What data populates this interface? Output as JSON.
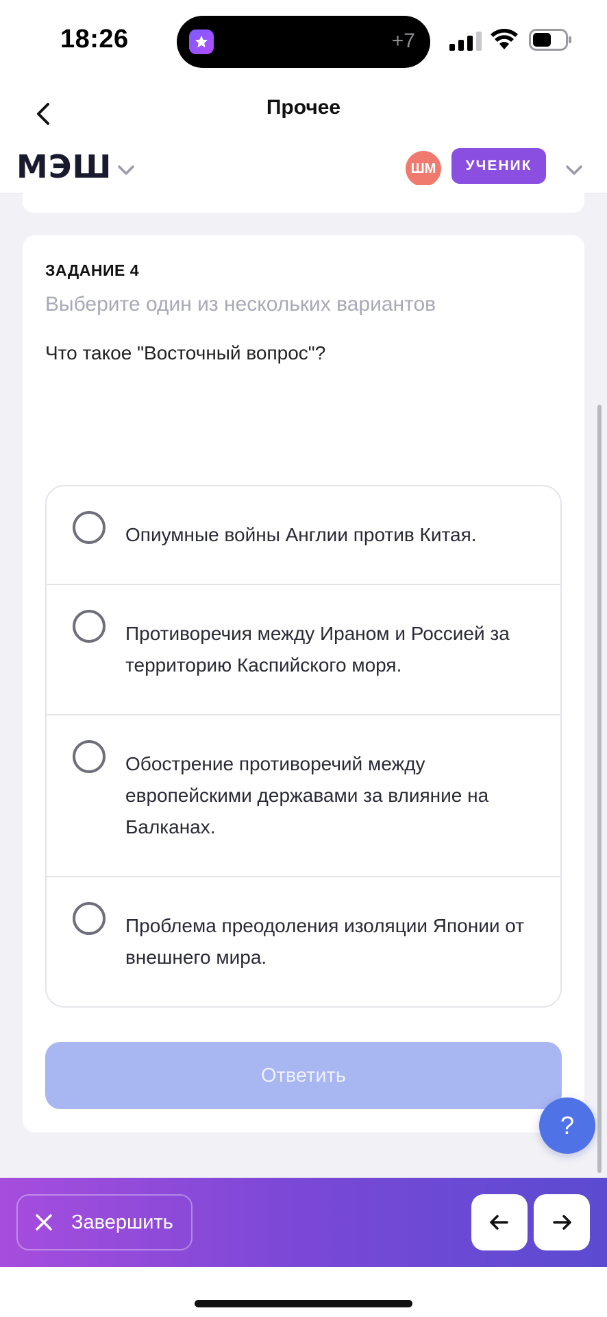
{
  "status_bar": {
    "time": "18:26",
    "island_count": "+7",
    "signal_icon": "cellular-signal-icon",
    "wifi_icon": "wifi-icon",
    "battery_icon": "battery-icon"
  },
  "nav": {
    "title": "Прочее",
    "back_icon": "chevron-left-icon"
  },
  "header": {
    "logo": "МЭШ",
    "avatar_initials": "ШМ",
    "role": "УЧЕНИК"
  },
  "task": {
    "label": "ЗАДАНИЕ 4",
    "hint": "Выберите один из нескольких вариантов",
    "question": "Что такое \"Восточный вопрос\"?",
    "options": [
      {
        "text": "Опиумные войны Англии против Китая."
      },
      {
        "text": "Противоречия между Ираном и Россией за территорию Каспийского моря."
      },
      {
        "text": "Обострение противоречий между европейскими державами за влияние на Балканах."
      },
      {
        "text": "Проблема преодоления изоляции Японии от внешнего мира."
      }
    ],
    "answer_label": "Ответить"
  },
  "help_label": "?",
  "bottom_bar": {
    "finish_label": "Завершить",
    "prev_icon": "arrow-left-icon",
    "next_icon": "arrow-right-icon"
  },
  "colors": {
    "accent_purple": "#8a4fe0",
    "answer_button_disabled": "#a8b6f2",
    "help_button": "#4f73e6",
    "avatar": "#f07a6e"
  }
}
